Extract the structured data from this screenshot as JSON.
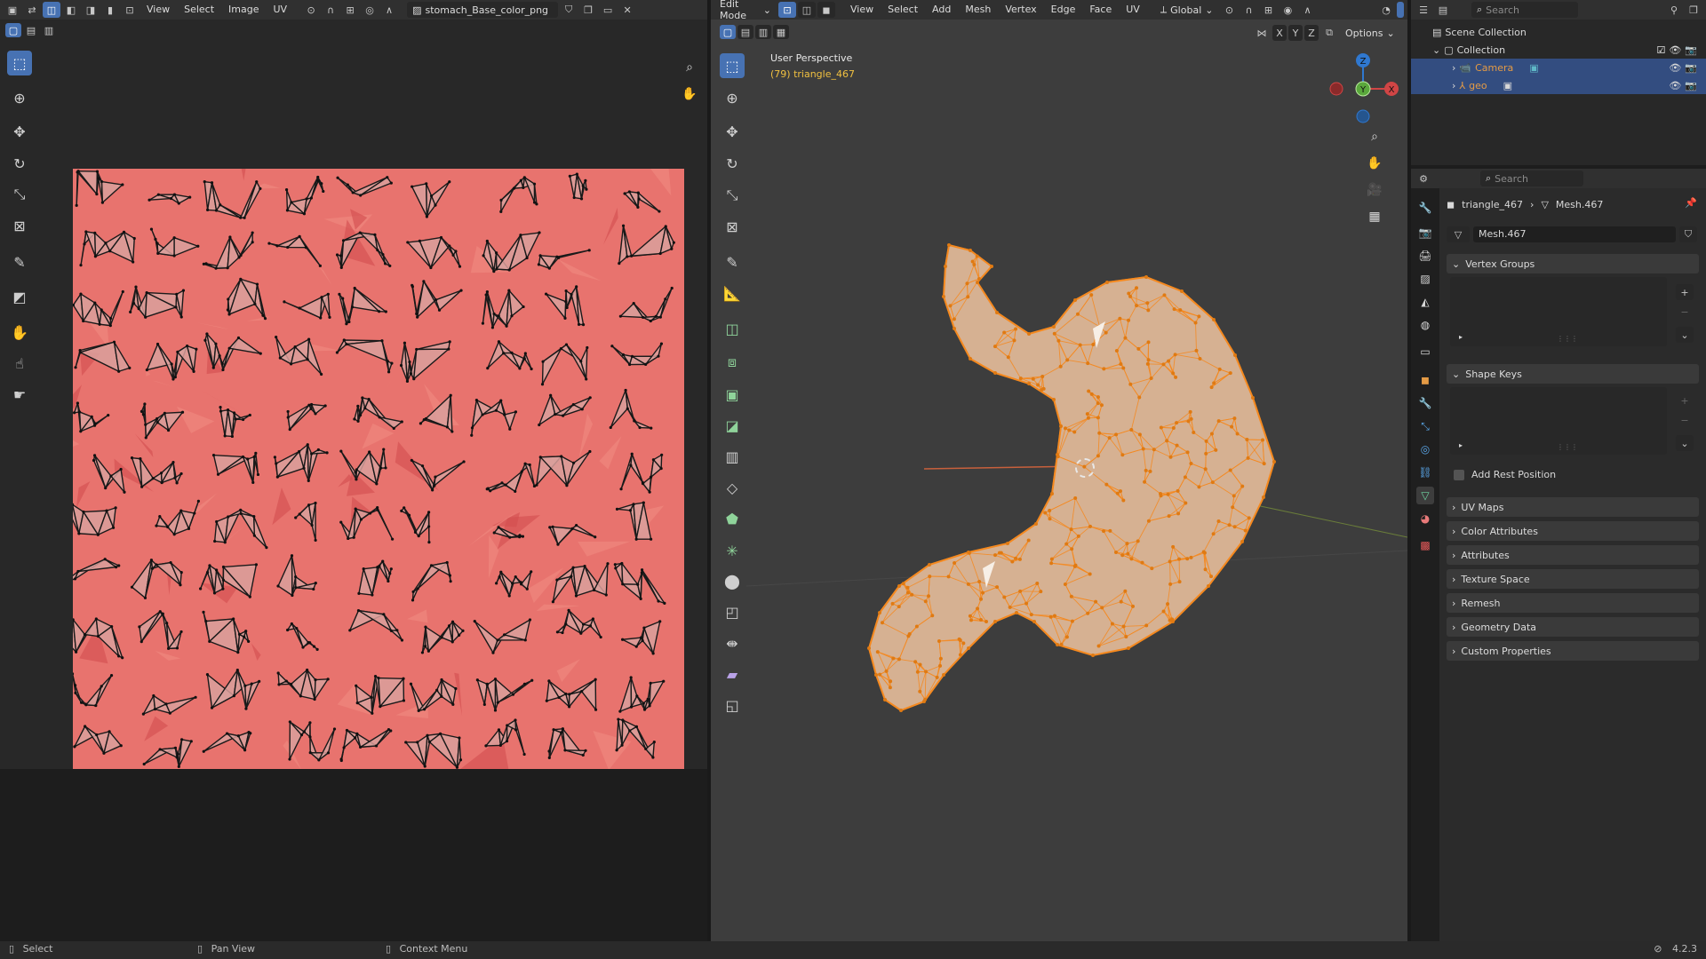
{
  "uv_editor": {
    "menus": [
      "View",
      "Select",
      "Image",
      "UV"
    ],
    "image_name": "stomach_Base_color_png"
  },
  "viewport": {
    "mode": "Edit Mode",
    "menus": [
      "View",
      "Select",
      "Add",
      "Mesh",
      "Vertex",
      "Edge",
      "Face",
      "UV"
    ],
    "transform_orientation": "Global",
    "axes": [
      "X",
      "Y",
      "Z"
    ],
    "options_label": "Options",
    "perspective_label": "User Perspective",
    "object_label": "(79) triangle_467",
    "gizmo": {
      "x": "X",
      "y": "Y",
      "z": "Z"
    }
  },
  "outliner": {
    "search_placeholder": "Search",
    "scene_collection": "Scene Collection",
    "collection": "Collection",
    "items": [
      {
        "name": "Camera",
        "color": "#e59b45"
      },
      {
        "name": "geo",
        "color": "#e59b45"
      }
    ]
  },
  "properties": {
    "search_placeholder": "Search",
    "breadcrumb_object": "triangle_467",
    "breadcrumb_mesh": "Mesh.467",
    "mesh_name": "Mesh.467",
    "vertex_groups": "Vertex Groups",
    "shape_keys": "Shape Keys",
    "add_rest_position": "Add Rest Position",
    "sections": [
      "UV Maps",
      "Color Attributes",
      "Attributes",
      "Texture Space",
      "Remesh",
      "Geometry Data",
      "Custom Properties"
    ]
  },
  "status_bar": {
    "select": "Select",
    "pan_view": "Pan View",
    "context_menu": "Context Menu",
    "version": "4.2.3"
  },
  "colors": {
    "accent": "#4772b3",
    "selection_orange": "#f5891f",
    "uv_texture": "#e8736e"
  }
}
